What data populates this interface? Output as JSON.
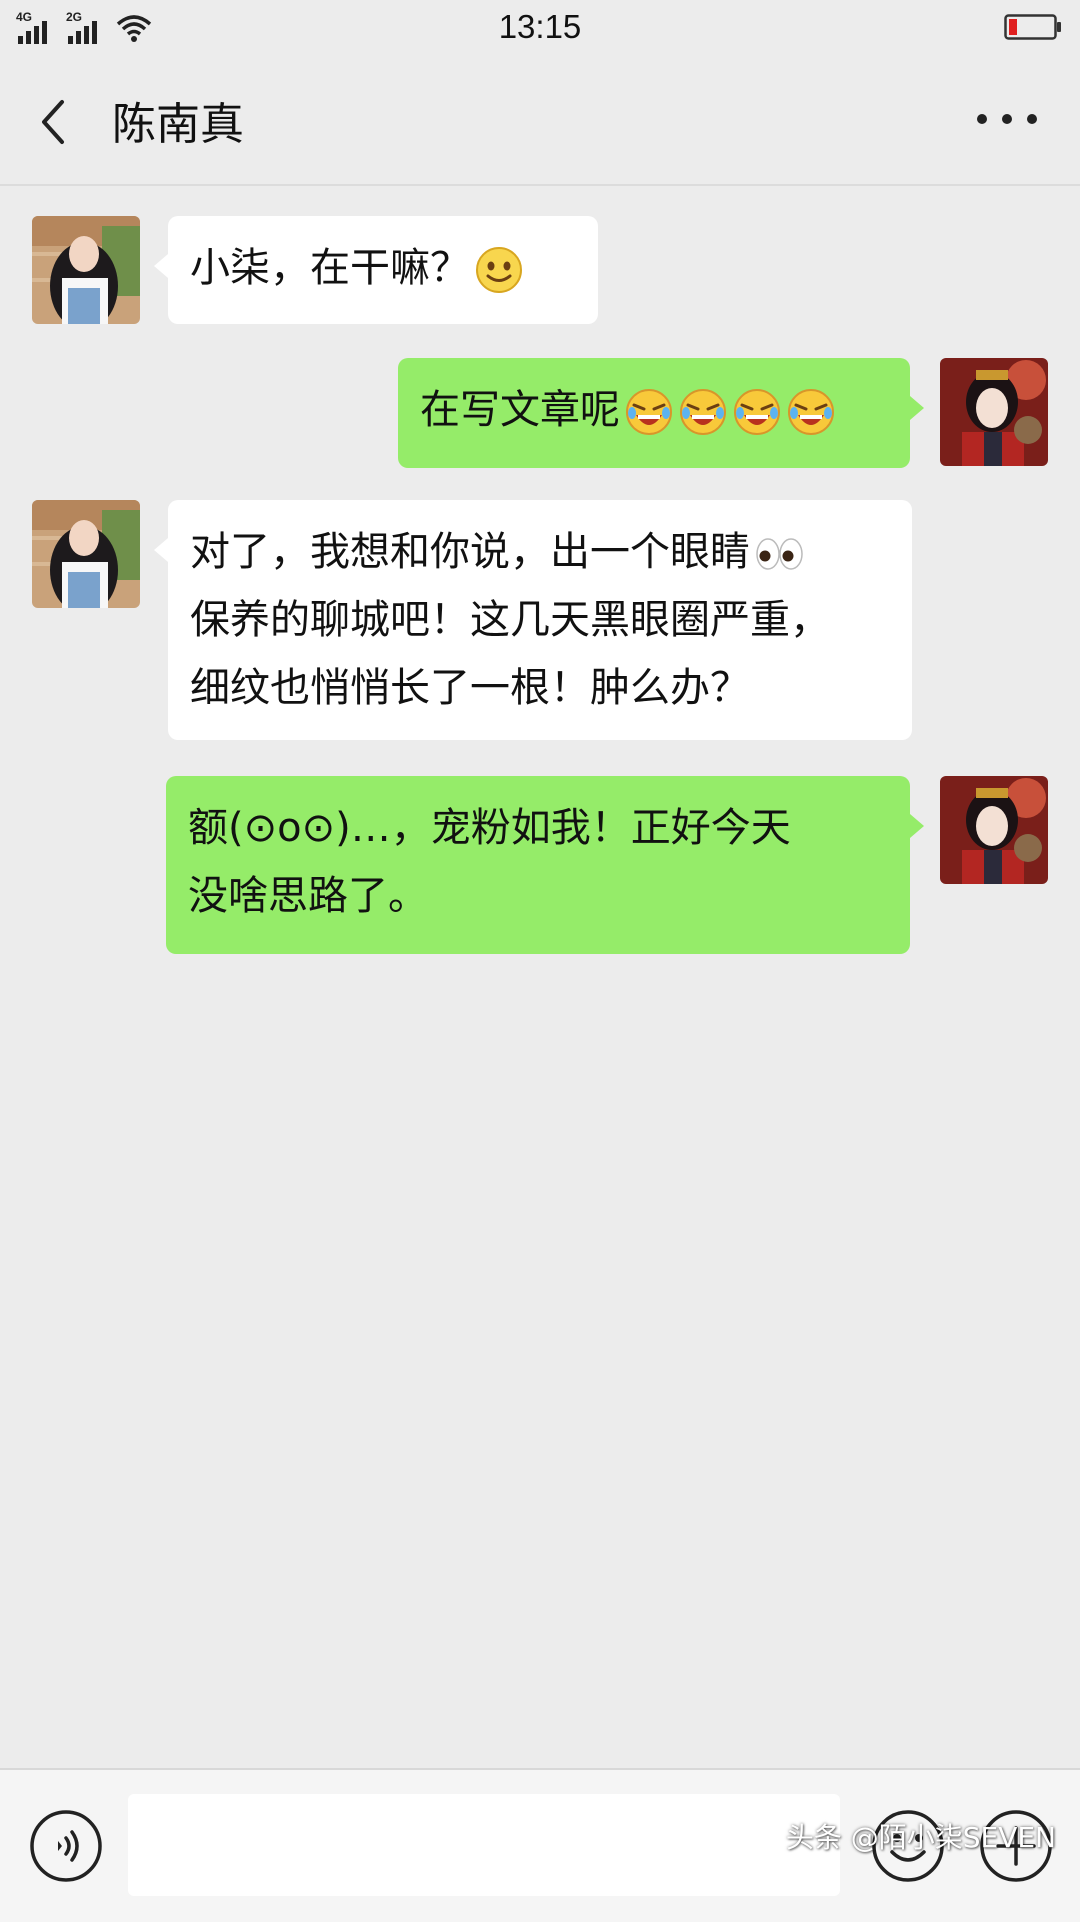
{
  "status_bar": {
    "network_1": "4G",
    "network_2": "2G",
    "time": "13:15",
    "battery_color": "#e02020",
    "icons": [
      "signal-icon",
      "wifi-icon",
      "battery-icon"
    ]
  },
  "header": {
    "title": "陈南真",
    "back_icon": "chevron-left-icon",
    "more_icon": "more-dots-icon"
  },
  "messages": [
    {
      "direction": "in",
      "text": "小柒，在干嘛？",
      "emoji": "smile"
    },
    {
      "direction": "out",
      "text": "在写文章呢",
      "emoji": "laugh-tears x4"
    },
    {
      "direction": "in",
      "line1": "对了，我想和你说，出一个眼睛",
      "line2": "保养的聊城吧！这几天黑眼圈严重，",
      "line3": "细纹也悄悄长了一根！肿么办？",
      "emoji": "eyes"
    },
    {
      "direction": "out",
      "line1": "额(⊙o⊙)…，宠粉如我！正好今天",
      "line2": "没啥思路了。"
    }
  ],
  "input_bar": {
    "placeholder": "",
    "icons": [
      "voice-icon",
      "emoji-icon",
      "plus-icon"
    ]
  },
  "watermark": "头条 @陌小柒SEVEN",
  "colors": {
    "background": "#ececec",
    "incoming_bubble": "#ffffff",
    "outgoing_bubble": "#95ec69"
  }
}
